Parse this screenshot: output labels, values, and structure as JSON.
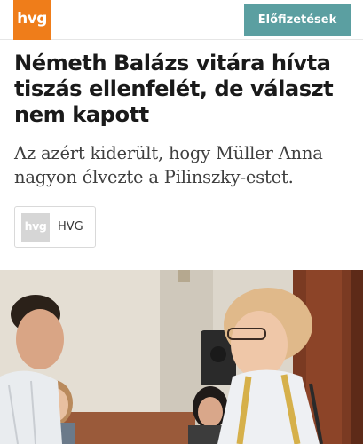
{
  "header": {
    "logo_text": "hvg",
    "subscribe_label": "Előfizetések",
    "colors": {
      "brand": "#ef7d1a",
      "subscribe": "#5b9fa1"
    }
  },
  "article": {
    "headline": "Németh Balázs vitára hívta tiszás ellenfelét, de választ nem kapott",
    "lead": "Az azért kiderült, hogy Müller Anna nagyon élvezte a Pilinszky-estet.",
    "author": {
      "avatar_text": "hvg",
      "name": "HVG"
    }
  }
}
